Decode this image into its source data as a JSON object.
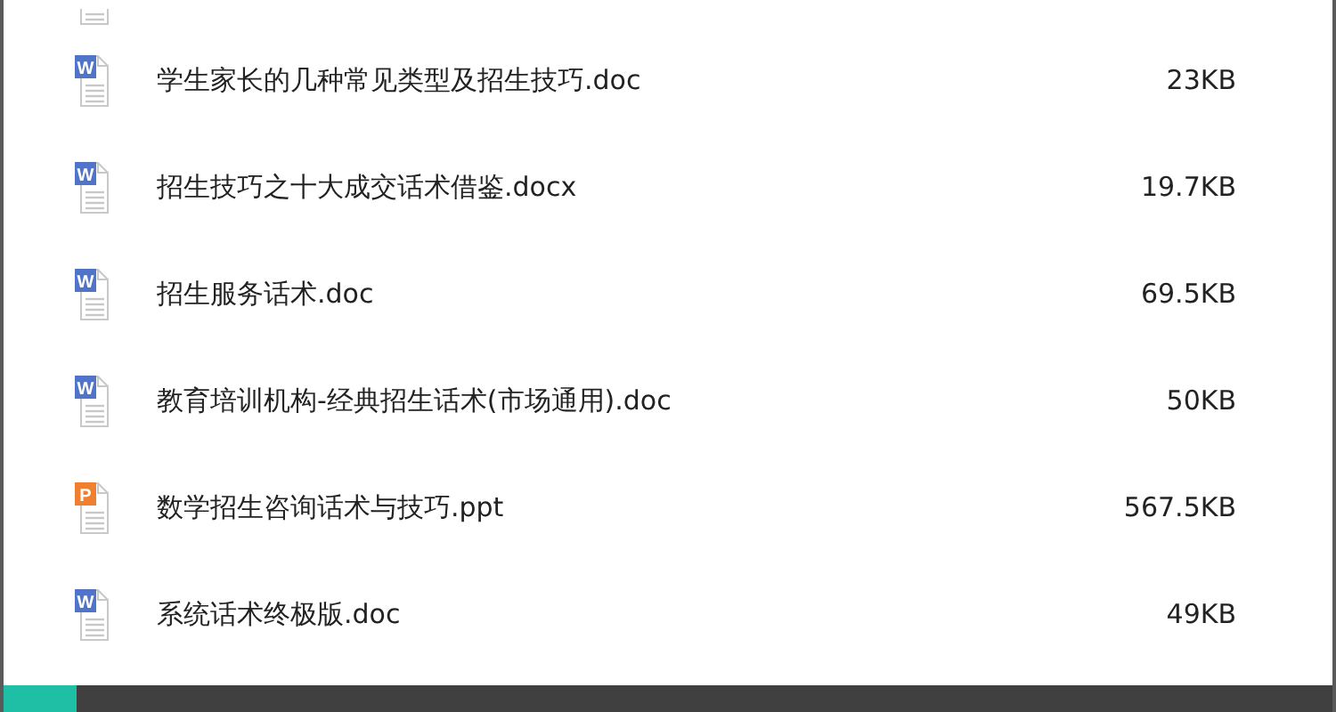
{
  "files": [
    {
      "kind": "word",
      "badge": "W",
      "name": "学生家长的几种常见类型及招生技巧.doc",
      "size": "23KB"
    },
    {
      "kind": "word",
      "badge": "W",
      "name": "招生技巧之十大成交话术借鉴.docx",
      "size": "19.7KB"
    },
    {
      "kind": "word",
      "badge": "W",
      "name": "招生服务话术.doc",
      "size": "69.5KB"
    },
    {
      "kind": "word",
      "badge": "W",
      "name": "教育培训机构-经典招生话术(市场通用).doc",
      "size": "50KB"
    },
    {
      "kind": "ppt",
      "badge": "P",
      "name": "数学招生咨询话术与技巧.ppt",
      "size": "567.5KB"
    },
    {
      "kind": "word",
      "badge": "W",
      "name": "系统话术终极版.doc",
      "size": "49KB"
    }
  ]
}
